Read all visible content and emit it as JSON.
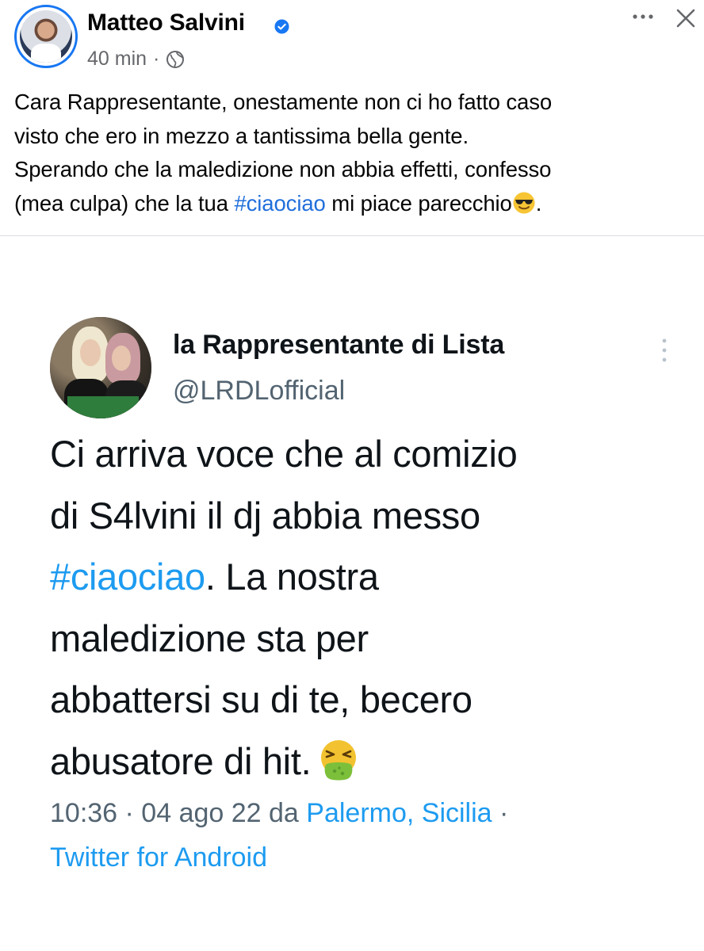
{
  "post": {
    "author": "Matteo Salvini",
    "time": "40 min",
    "separator": "·",
    "text_lines": [
      "Cara Rappresentante, onestamente non ci ho fatto caso",
      "visto che ero in mezzo a tantissima bella gente.",
      "Sperando che la maledizione non abbia effetti, confesso"
    ],
    "last_line": {
      "before": "(mea culpa) che la tua ",
      "hashtag": "#ciaociao",
      "after": " mi piace parecchio",
      "end": "."
    },
    "icons": {
      "verified": "verified-badge-icon",
      "audience": "globe-icon",
      "more": "more-options-icon",
      "close": "close-icon",
      "emoji": "smiling-face-with-sunglasses-icon"
    },
    "colors": {
      "hashtag": "#216fdb",
      "verified": "#1877f2",
      "meta": "#65676b"
    }
  },
  "tweet": {
    "name": "la Rappresentante di Lista",
    "handle": "@LRDLofficial",
    "body_lines": [
      "Ci arriva voce che al comizio",
      "di S4lvini il dj abbia messo"
    ],
    "hashtag_line": {
      "hashtag": "#ciaociao",
      "after": ". La nostra"
    },
    "body_lines_2": [
      "maledizione sta per",
      "abbattersi su di te, becero"
    ],
    "last_body_line": "abusatore di hit.",
    "meta": {
      "time_date": "10:36 · 04 ago 22 da ",
      "location": "Palermo, Sicilia",
      "separator": " ·",
      "client": "Twitter for Android"
    },
    "icons": {
      "more": "vertical-more-icon",
      "emoji": "face-vomiting-icon"
    },
    "colors": {
      "link": "#1d9bf0",
      "meta": "#536471"
    }
  }
}
